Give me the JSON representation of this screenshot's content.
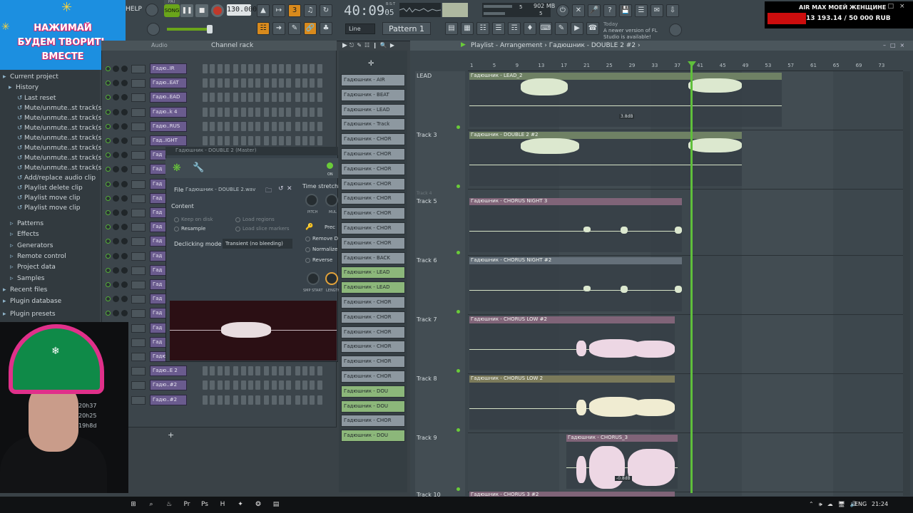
{
  "toolbar": {
    "help_label": "HELP",
    "song_label": "SONG",
    "pat_label": "PAT",
    "tempo": "130.000",
    "time_main": "40:09",
    "time_frac": "05",
    "time_unit": "B:S:T",
    "cpu_value": "5",
    "memory": "902 MB",
    "cpu_poly": "5",
    "snap_mode": "Line",
    "pattern": "Pattern 1",
    "update_day": "Today",
    "update_text": "A newer version of FL Studio is available!"
  },
  "stream_overlay": {
    "banner_line1": "НАЖИМАЙ",
    "banner_line2": "БУДЕМ ТВОРИТЬ ВМЕСТЕ",
    "project_title": "AIR MAX МОЕЙ ЖЕНЩИНЕ",
    "donation_progress": "13 193.14 / 50 000 RUB",
    "donation_fraction": 0.264
  },
  "browser": {
    "items": [
      {
        "label": "Current project",
        "icon": "folder-icon"
      },
      {
        "label": "History",
        "icon": "history-icon"
      },
      {
        "label": "Last reset",
        "icon": "undo-icon"
      },
      {
        "label": "Mute/unmute..st track(s)",
        "icon": "undo-icon"
      },
      {
        "label": "Mute/unmute..st track(s)",
        "icon": "undo-icon"
      },
      {
        "label": "Mute/unmute..st track(s)",
        "icon": "undo-icon"
      },
      {
        "label": "Mute/unmute..st track(s)",
        "icon": "undo-icon"
      },
      {
        "label": "Mute/unmute..st track(s)",
        "icon": "undo-icon"
      },
      {
        "label": "Mute/unmute..st track(s)",
        "icon": "undo-icon"
      },
      {
        "label": "Mute/unmute..st track(s)",
        "icon": "undo-icon"
      },
      {
        "label": "Add/replace audio clip",
        "icon": "undo-icon"
      },
      {
        "label": "Playlist delete clip",
        "icon": "undo-icon"
      },
      {
        "label": "Playlist move clip",
        "icon": "undo-icon"
      },
      {
        "label": "Playlist move clip",
        "icon": "undo-icon"
      },
      {
        "label": "Patterns",
        "icon": "patterns-icon"
      },
      {
        "label": "Effects",
        "icon": "effects-icon"
      },
      {
        "label": "Generators",
        "icon": "generators-icon"
      },
      {
        "label": "Remote control",
        "icon": "remote-icon"
      },
      {
        "label": "Project data",
        "icon": "data-icon"
      },
      {
        "label": "Samples",
        "icon": "samples-icon"
      },
      {
        "label": "Recent files",
        "icon": "folder-icon"
      },
      {
        "label": "Plugin database",
        "icon": "plugin-icon"
      },
      {
        "label": "Plugin presets",
        "icon": "plugin-icon"
      }
    ]
  },
  "channel_rack": {
    "title": "Channel rack",
    "filter": "Audio",
    "channels": [
      {
        "name": "Гадю..IR",
        "color": "purple"
      },
      {
        "name": "Гадю..EAT",
        "color": "purple"
      },
      {
        "name": "Гадю..EAD",
        "color": "purple"
      },
      {
        "name": "Гадю..k 4",
        "color": "purple"
      },
      {
        "name": "Гадю..RUS",
        "color": "purple"
      },
      {
        "name": "Гад..IGHT",
        "color": "purple"
      },
      {
        "name": "Гад",
        "color": "purple"
      },
      {
        "name": "Гад",
        "color": "purple"
      },
      {
        "name": "Гад",
        "color": "purple"
      },
      {
        "name": "Гад",
        "color": "purple"
      },
      {
        "name": "Гад",
        "color": "purple"
      },
      {
        "name": "Гад",
        "color": "purple"
      },
      {
        "name": "Гад",
        "color": "purple"
      },
      {
        "name": "Гад",
        "color": "purple"
      },
      {
        "name": "Гад",
        "color": "purple"
      },
      {
        "name": "Гад",
        "color": "purple"
      },
      {
        "name": "Гад",
        "color": "purple"
      },
      {
        "name": "Гад",
        "color": "purple"
      },
      {
        "name": "Гад",
        "color": "purple"
      },
      {
        "name": "Гад",
        "color": "purple"
      },
      {
        "name": "Гадю..E 1",
        "color": "purple"
      },
      {
        "name": "Гадю..E 2",
        "color": "purple"
      },
      {
        "name": "Гадю..#2",
        "color": "purple"
      },
      {
        "name": "Гадю..#2",
        "color": "purple"
      }
    ]
  },
  "clip_dialog": {
    "title": "Гадюшник - DOUBLE 2 (Master)",
    "file_label": "File",
    "file_name": "Гадюшник - DOUBLE 2.wav",
    "content_label": "Content",
    "keep_on_disk": "Keep on disk",
    "resample": "Resample",
    "load_regions": "Load regions",
    "load_slice_markers": "Load slice markers",
    "declicking_label": "Declicking mode",
    "declicking_value": "Transient (no bleeding)",
    "time_stretching": "Time stretchin",
    "pitch_label": "PITCH",
    "mul_label": "MUL",
    "precompute": "Prec",
    "remove_dc": "Remove D",
    "normalize": "Normalize",
    "reverse": "Reverse",
    "smp_start": "SMP START",
    "length": "LENGTH",
    "on_label": "ON"
  },
  "pattern_picker": {
    "patterns": [
      {
        "name": "Гадюшник - AIR",
        "color": "slate"
      },
      {
        "name": "Гадюшник - BEAT",
        "color": "slate"
      },
      {
        "name": "Гадюшник - LEAD",
        "color": "slate"
      },
      {
        "name": "Гадюшник - Track",
        "color": "slate"
      },
      {
        "name": "Гадюшник - CHOR",
        "color": "slate"
      },
      {
        "name": "Гадюшник - CHOR",
        "color": "slate"
      },
      {
        "name": "Гадюшник - CHOR",
        "color": "slate"
      },
      {
        "name": "Гадюшник - CHOR",
        "color": "slate"
      },
      {
        "name": "Гадюшник - CHOR",
        "color": "slate"
      },
      {
        "name": "Гадюшник - CHOR",
        "color": "slate"
      },
      {
        "name": "Гадюшник - CHOR",
        "color": "slate"
      },
      {
        "name": "Гадюшник - CHOR",
        "color": "slate"
      },
      {
        "name": "Гадюшник - BACK",
        "color": "slate"
      },
      {
        "name": "Гадюшник - LEAD",
        "color": "green"
      },
      {
        "name": "Гадюшник - LEAD",
        "color": "green"
      },
      {
        "name": "Гадюшник - CHOR",
        "color": "slate"
      },
      {
        "name": "Гадюшник - CHOR",
        "color": "slate"
      },
      {
        "name": "Гадюшник - CHOR",
        "color": "slate"
      },
      {
        "name": "Гадюшник - CHOR",
        "color": "slate"
      },
      {
        "name": "Гадюшник - CHOR",
        "color": "slate"
      },
      {
        "name": "Гадюшник - CHOR",
        "color": "slate"
      },
      {
        "name": "Гадюшник - DOU",
        "color": "green"
      },
      {
        "name": "Гадюшник - DOU",
        "color": "green"
      },
      {
        "name": "Гадюшник - CHOR",
        "color": "slate"
      },
      {
        "name": "Гадюшник - DOU",
        "color": "green"
      }
    ]
  },
  "playlist": {
    "title": "Playlist - Arrangement",
    "breadcrumb": "Гадюшник - DOUBLE 2 #2",
    "ruler": [
      "1",
      "5",
      "9",
      "13",
      "17",
      "21",
      "25",
      "29",
      "33",
      "37",
      "41",
      "45",
      "49",
      "53",
      "57",
      "61",
      "65",
      "69",
      "73"
    ],
    "playhead_bar": 40.5,
    "tracks": [
      {
        "label": "LEAD"
      },
      {
        "label": "Track 3"
      },
      {
        "label": "Track 4"
      },
      {
        "label": "Track 5"
      },
      {
        "label": "Track 6"
      },
      {
        "label": "Track 7"
      },
      {
        "label": "Track 8"
      },
      {
        "label": "Track 9"
      },
      {
        "label": "Track 10"
      }
    ],
    "clips": [
      {
        "title": "Гадюшник - LEAD_2",
        "gain": "3.8dB"
      },
      {
        "title": "Гадюшник - DOUBLE 2 #2",
        "gain": ""
      },
      {
        "title": "Гадюшник - CHORUS NIGHT 3",
        "gain": ""
      },
      {
        "title": "Гадюшник - CHORUS NIGHT #2",
        "gain": ""
      },
      {
        "title": "Гадюшник - CHORUS LOW #2",
        "gain": ""
      },
      {
        "title": "Гадюшник - CHORUS LOW 2",
        "gain": ""
      },
      {
        "title": "Гадюшник - CHORUS_3",
        "gain": "-0.8dB"
      },
      {
        "title": "Гадюшник - CHORUS 3 #2",
        "gain": ""
      }
    ]
  },
  "webcam": {
    "times": [
      "20h37",
      "20h25",
      "19h8d"
    ]
  },
  "taskbar": {
    "language": "ENG",
    "clock": "21:24",
    "apps": [
      "windows-icon",
      "search-icon",
      "steam-icon",
      "premiere-icon",
      "photoshop-icon",
      "h-icon",
      "fl-icon",
      "flstudio-icon",
      "folder-icon"
    ]
  },
  "colors": {
    "accent_green": "#5fbf3b",
    "accent_orange": "#d98a1c",
    "banner_blue": "#1c8fe0",
    "record_red": "#c0392b",
    "donation_red": "#cc0d0d"
  }
}
